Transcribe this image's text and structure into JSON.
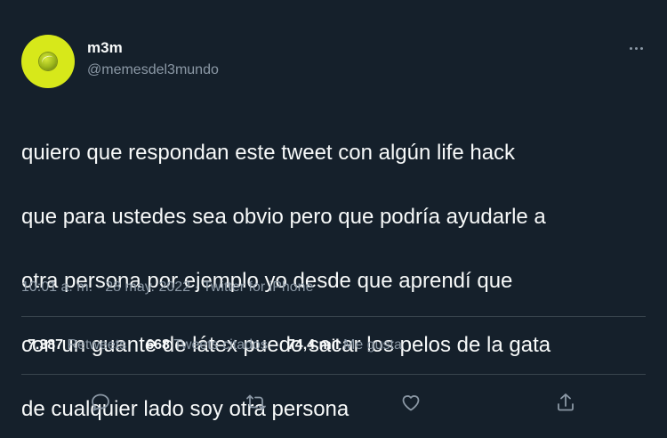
{
  "user": {
    "display_name": "m3m",
    "handle": "@memesdel3mundo",
    "avatar_icon": "tennis-ball-icon"
  },
  "tweet": {
    "text_lines": [
      "quiero que respondan este tweet con algún life hack",
      "que para ustedes sea obvio pero que podría ayudarle a",
      "otra persona por ejemplo yo desde que aprendí que",
      "con un guante de látex puedo sacar los pelos de la gata",
      "de cualquier lado soy otra persona"
    ],
    "meta": "10:01 a. m. · 28 may. 2022 · Twitter for iPhone"
  },
  "stats": {
    "retweets_count": "7.387",
    "retweets_label": "Retweets",
    "quotes_count": "668",
    "quotes_label": "Tweets citados",
    "likes_count": "74,4 mil",
    "likes_label": "Me gusta"
  },
  "actions": {
    "reply_icon": "reply-icon",
    "retweet_icon": "retweet-icon",
    "like_icon": "heart-icon",
    "share_icon": "share-icon"
  },
  "colors": {
    "background": "#15202b",
    "text": "#f7f9f9",
    "secondary": "#8b98a5",
    "avatar": "#d7e81a",
    "divider": "#38444d"
  }
}
